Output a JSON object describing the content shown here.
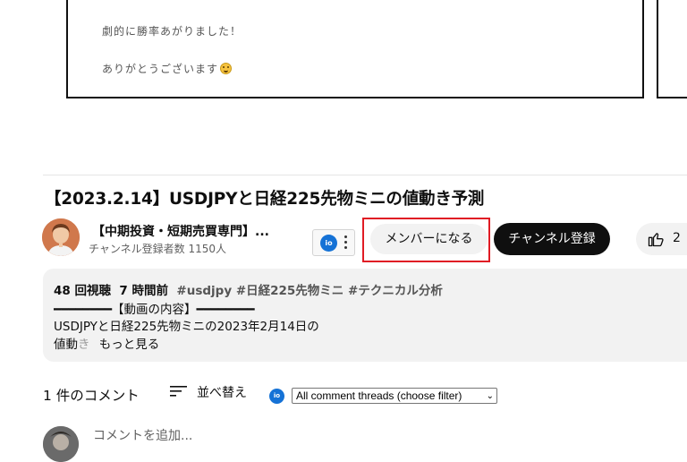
{
  "frame": {
    "line1": "劇的に勝率あがりました！",
    "line2": "ありがとうございます"
  },
  "video": {
    "title": "【2023.2.14】USDJPYと日経225先物ミニの値動き予測"
  },
  "channel": {
    "name": "【中期投資・短期売買専門】...",
    "subscribers": "チャンネル登録者数 1150人",
    "join_label": "メンバーになる",
    "subscribe_label": "チャンネル登録",
    "likes": "2"
  },
  "extension": {
    "badge": "io"
  },
  "description": {
    "views": "48 回視聴",
    "age": "7 時間前",
    "hashtags": "#usdjpy #日経225先物ミニ #テクニカル分析",
    "line1": "━━━━━━━━【動画の内容】━━━━━━━━",
    "line2": "USDJPYと日経225先物ミニの2023年2月14日の",
    "line3_main": "値動",
    "line3_fade": "き",
    "more_label": "もっと見る"
  },
  "comments": {
    "count_label": "1 件のコメント",
    "sort_label": "並べ替え",
    "filter_value": "All comment threads (choose filter)",
    "input_placeholder": "コメントを追加..."
  },
  "colors": {
    "accent_red": "#e01b24",
    "subscribe_bg": "#0f0f0f",
    "extension_blue": "#1572d6"
  }
}
